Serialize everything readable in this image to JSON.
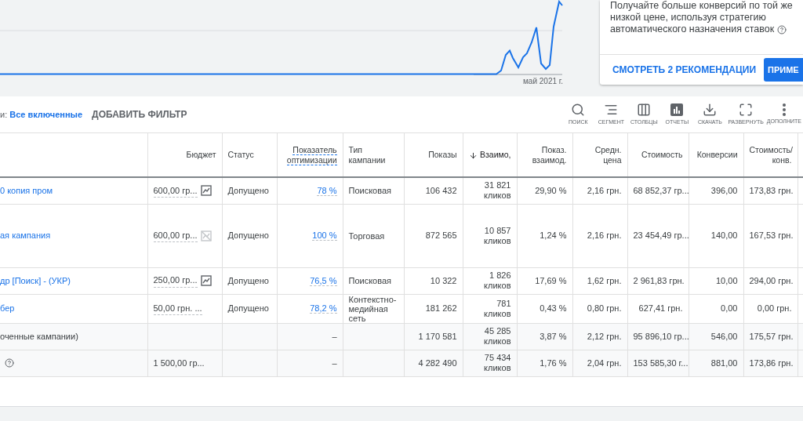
{
  "chart": {
    "x_label": "май 2021 г."
  },
  "recommendation": {
    "text_lines": [
      "Получайте больше конверсий по той же",
      "низкой цене, используя стратегию",
      "автоматического назначения ставок"
    ],
    "link": "СМОТРЕТЬ 2 РЕКОМЕНДАЦИИ",
    "button": "ПРИМЕ"
  },
  "toolbar": {
    "filter_prefix": "и:",
    "filter_value": "Все включенные",
    "add_filter": "ДОБАВИТЬ ФИЛЬТР",
    "tools": [
      {
        "kind": "search",
        "label": "ПОИСК"
      },
      {
        "kind": "segment",
        "label": "СЕГМЕНТ"
      },
      {
        "kind": "columns",
        "label": "СТОЛБЦЫ"
      },
      {
        "kind": "reports",
        "label": "ОТЧЕТЫ"
      },
      {
        "kind": "download",
        "label": "СКАЧАТЬ"
      },
      {
        "kind": "expand",
        "label": "РАЗВЕРНУТЬ"
      },
      {
        "kind": "more",
        "label": "ДОПОЛНИТЕ"
      }
    ]
  },
  "table": {
    "columns": [
      {
        "sorted": false
      },
      {
        "label": "Бюджет",
        "sorted": false
      },
      {
        "label": "Статус",
        "sorted": false
      },
      {
        "label": "Показатель оптимизации",
        "sorted": false
      },
      {
        "label": "Тип кампании",
        "sorted": false
      },
      {
        "label": "Показы",
        "sorted": false
      },
      {
        "label": "Взаимо,",
        "sorted": true
      },
      {
        "label": "Показ. взаимод.",
        "sorted": false
      },
      {
        "label": "Средн. цена",
        "sorted": false
      },
      {
        "label": "Стоимость",
        "sorted": false
      },
      {
        "label": "Конверсии",
        "sorted": false
      },
      {
        "label": "Стоимость/ конв.",
        "sorted": false
      }
    ],
    "rows": [
      {
        "kind": "campaign",
        "name": "0 копия пром",
        "budget": "600,00 гр...",
        "trend_chart": true,
        "trend_disabled": false,
        "status": "Допущено",
        "optimization": "78 %",
        "type": "Поисковая",
        "impressions": "106 432",
        "interactions": "31 821",
        "interactions_unit": "кликов",
        "rate": "29,90 %",
        "avg": "2,16 грн.",
        "cost": "68 852,37 гр...",
        "conversions": "396,00",
        "cost_per_conv": "173,83 грн."
      },
      {
        "kind": "campaign",
        "name": "ая кампания",
        "budget": "600,00 гр...",
        "trend_chart": true,
        "trend_disabled": true,
        "status": "Допущено",
        "optimization": "100 %",
        "type": "Торговая",
        "impressions": "872 565",
        "interactions": "10 857",
        "interactions_unit": "кликов",
        "rate": "1,24 %",
        "avg": "2,16 грн.",
        "cost": "23 454,49 гр...",
        "conversions": "140,00",
        "cost_per_conv": "167,53 грн."
      },
      {
        "kind": "campaign",
        "name": "др [Поиск] - (УКР)",
        "budget": "250,00 гр...",
        "trend_chart": true,
        "trend_disabled": false,
        "status": "Допущено",
        "optimization": "76,5 %",
        "type": "Поисковая",
        "impressions": "10 322",
        "interactions": "1 826",
        "interactions_unit": "кликов",
        "rate": "17,69 %",
        "avg": "1,62 грн.",
        "cost": "2 961,83 грн.",
        "conversions": "10,00",
        "cost_per_conv": "294,00 грн."
      },
      {
        "kind": "campaign",
        "name": "бер",
        "budget": "50,00 грн. ...",
        "trend_chart": false,
        "status": "Допущено",
        "optimization": "78,2 %",
        "type": "Контекстно-медийная сеть",
        "impressions": "181 262",
        "interactions": "781",
        "interactions_unit": "кликов",
        "rate": "0,43 %",
        "avg": "0,80 грн.",
        "cost": "627,41 грн.",
        "conversions": "0,00",
        "cost_per_conv": "0,00 грн."
      },
      {
        "kind": "summary",
        "name": "оченные кампании)",
        "optimization": "–",
        "impressions": "1 170 581",
        "interactions": "45 285",
        "interactions_unit": "кликов",
        "rate": "3,87 %",
        "avg": "2,12 грн.",
        "cost": "95 896,10 гр...",
        "conversions": "546,00",
        "cost_per_conv": "175,57 грн."
      },
      {
        "kind": "summary",
        "help": true,
        "budget": "1 500,00 гр...",
        "optimization": "–",
        "impressions": "4 282 490",
        "interactions": "75 434",
        "interactions_unit": "кликов",
        "rate": "1,76 %",
        "avg": "2,04 грн.",
        "cost": "153 585,30 г...",
        "conversions": "881,00",
        "cost_per_conv": "173,86 грн."
      }
    ]
  }
}
